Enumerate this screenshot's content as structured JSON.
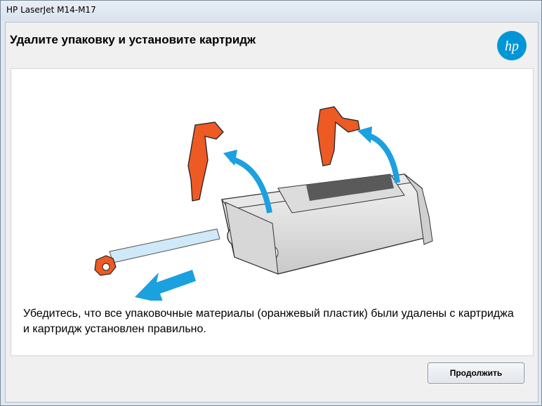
{
  "window": {
    "title": "HP LaserJet M14-M17"
  },
  "header": {
    "title": "Удалите упаковку и установите картридж"
  },
  "logo": {
    "icon": "hp-logo-icon",
    "text": "hp",
    "color": "#0096d6"
  },
  "illustration": {
    "icon": "cartridge-packaging-removal-illustration",
    "accent": "#ee5a24",
    "arrow_color": "#1ba0e0"
  },
  "content": {
    "message": "Убедитесь, что все упаковочные материалы (оранжевый пластик) были удалены с картриджа и картридж установлен правильно."
  },
  "actions": {
    "continue_label": "Продолжить"
  }
}
